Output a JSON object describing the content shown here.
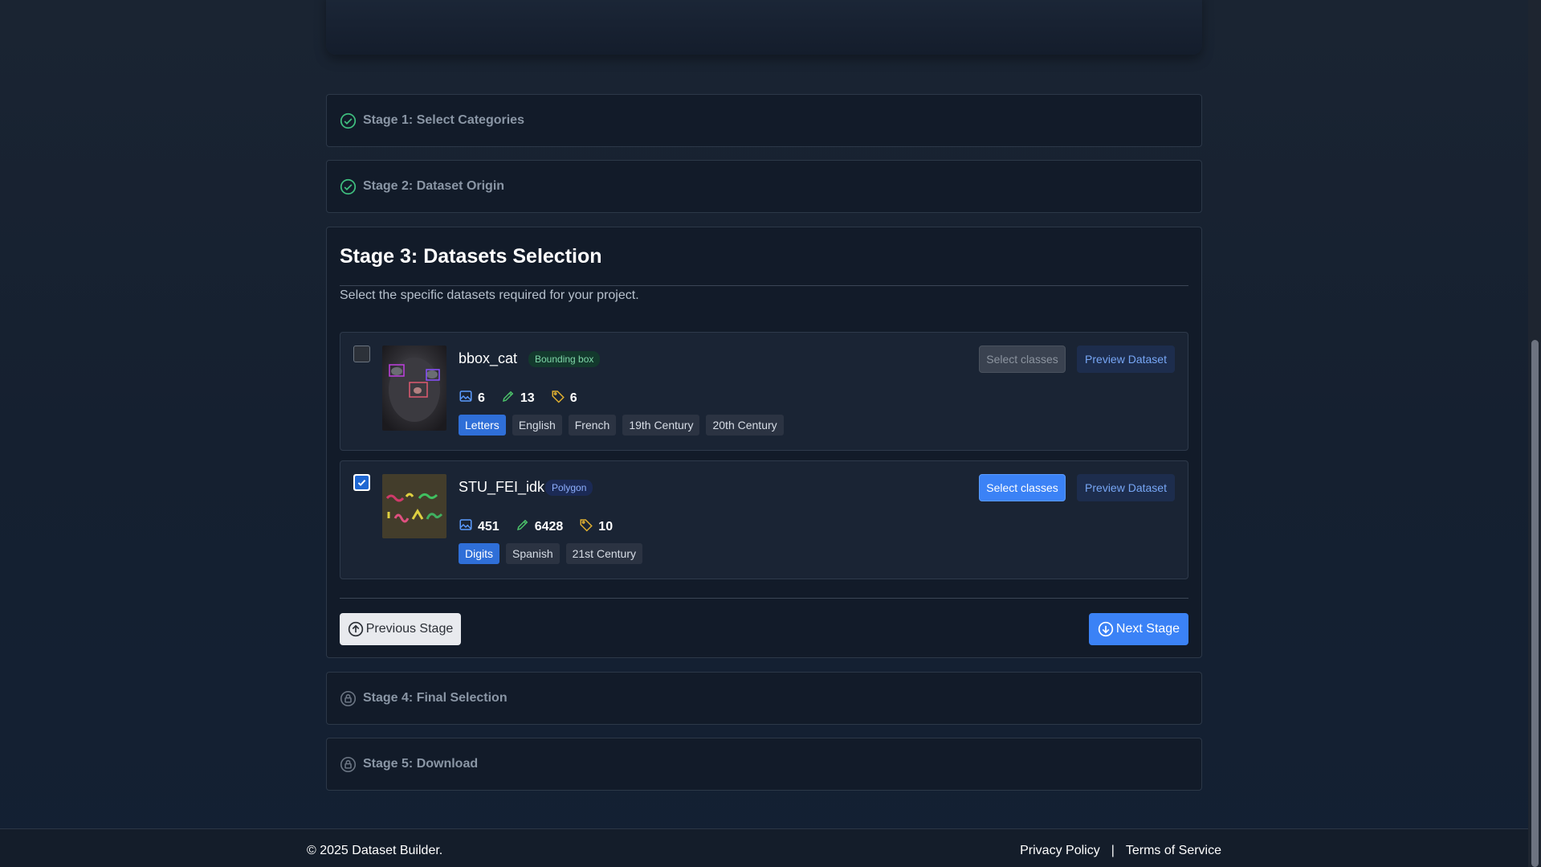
{
  "stages": {
    "stage1": {
      "title": "Stage 1: Select Categories",
      "status": "completed"
    },
    "stage2": {
      "title": "Stage 2: Dataset Origin",
      "status": "completed"
    },
    "stage3": {
      "title": "Stage 3: Datasets Selection",
      "description": "Select the specific datasets required for your project.",
      "datasets": [
        {
          "name": "bbox_cat",
          "type": "Bounding box",
          "checked": false,
          "images": "6",
          "annotations": "13",
          "classes": "6",
          "tags": [
            "Letters",
            "English",
            "French",
            "19th Century",
            "20th Century"
          ],
          "select_label": "Select classes",
          "preview_label": "Preview Dataset"
        },
        {
          "name": "STU_FEI_idk",
          "type": "Polygon",
          "checked": true,
          "images": "451",
          "annotations": "6428",
          "classes": "10",
          "tags": [
            "Digits",
            "Spanish",
            "21st Century"
          ],
          "select_label": "Select classes",
          "preview_label": "Preview Dataset"
        }
      ],
      "prev_label": "Previous Stage",
      "next_label": "Next Stage"
    },
    "stage4": {
      "title": "Stage 4: Final Selection",
      "status": "locked"
    },
    "stage5": {
      "title": "Stage 5: Download",
      "status": "locked"
    }
  },
  "footer": {
    "copyright": "© 2025 Dataset Builder.",
    "privacy": "Privacy Policy",
    "separator": "|",
    "terms": "Terms of Service"
  },
  "colors": {
    "accent": "#3b82f6",
    "success": "#3fbf7f",
    "badge_bbox": "#7fd6a8",
    "badge_poly": "#8fb0ff"
  }
}
